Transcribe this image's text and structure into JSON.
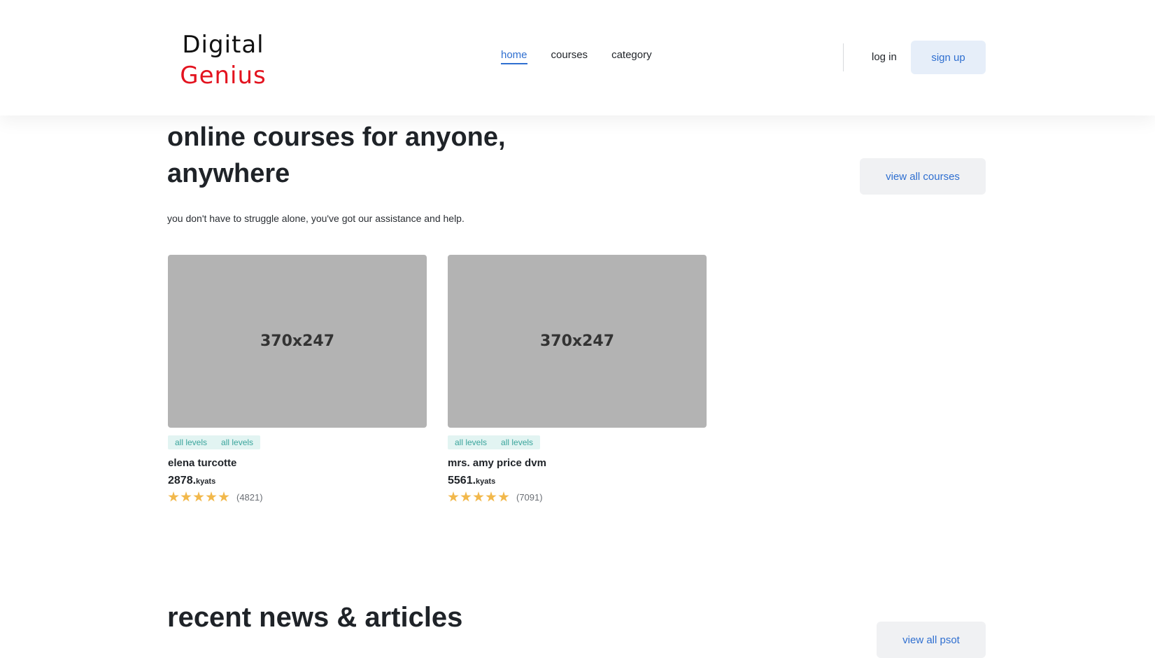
{
  "header": {
    "logo": {
      "line1": "Digital",
      "line2": "Genius"
    },
    "nav": [
      {
        "label": "home",
        "active": true
      },
      {
        "label": "courses",
        "active": false
      },
      {
        "label": "category",
        "active": false
      }
    ],
    "login_label": "log in",
    "signup_label": "sign up"
  },
  "hero": {
    "title": "online courses for anyone, anywhere",
    "subtitle": "you don't have to struggle alone, you've got our assistance and help.",
    "view_all_label": "view all courses"
  },
  "courses": [
    {
      "image_label": "370x247",
      "tags": [
        "all levels",
        "all levels"
      ],
      "name": "elena turcotte",
      "price": "2878.",
      "currency": "kyats",
      "stars": 5,
      "reviews": "(4821)"
    },
    {
      "image_label": "370x247",
      "tags": [
        "all levels",
        "all levels"
      ],
      "name": "mrs. amy price dvm",
      "price": "5561.",
      "currency": "kyats",
      "stars": 5,
      "reviews": "(7091)"
    }
  ],
  "news": {
    "title": "recent news & articles",
    "view_all_label": "view all psot"
  },
  "colors": {
    "accent": "#2f6fd0",
    "logo_red": "#e3131f",
    "tag_text": "#3aa59c",
    "tag_bg": "#e2f4f2",
    "star": "#f2b84b",
    "placeholder": "#b3b3b3"
  }
}
